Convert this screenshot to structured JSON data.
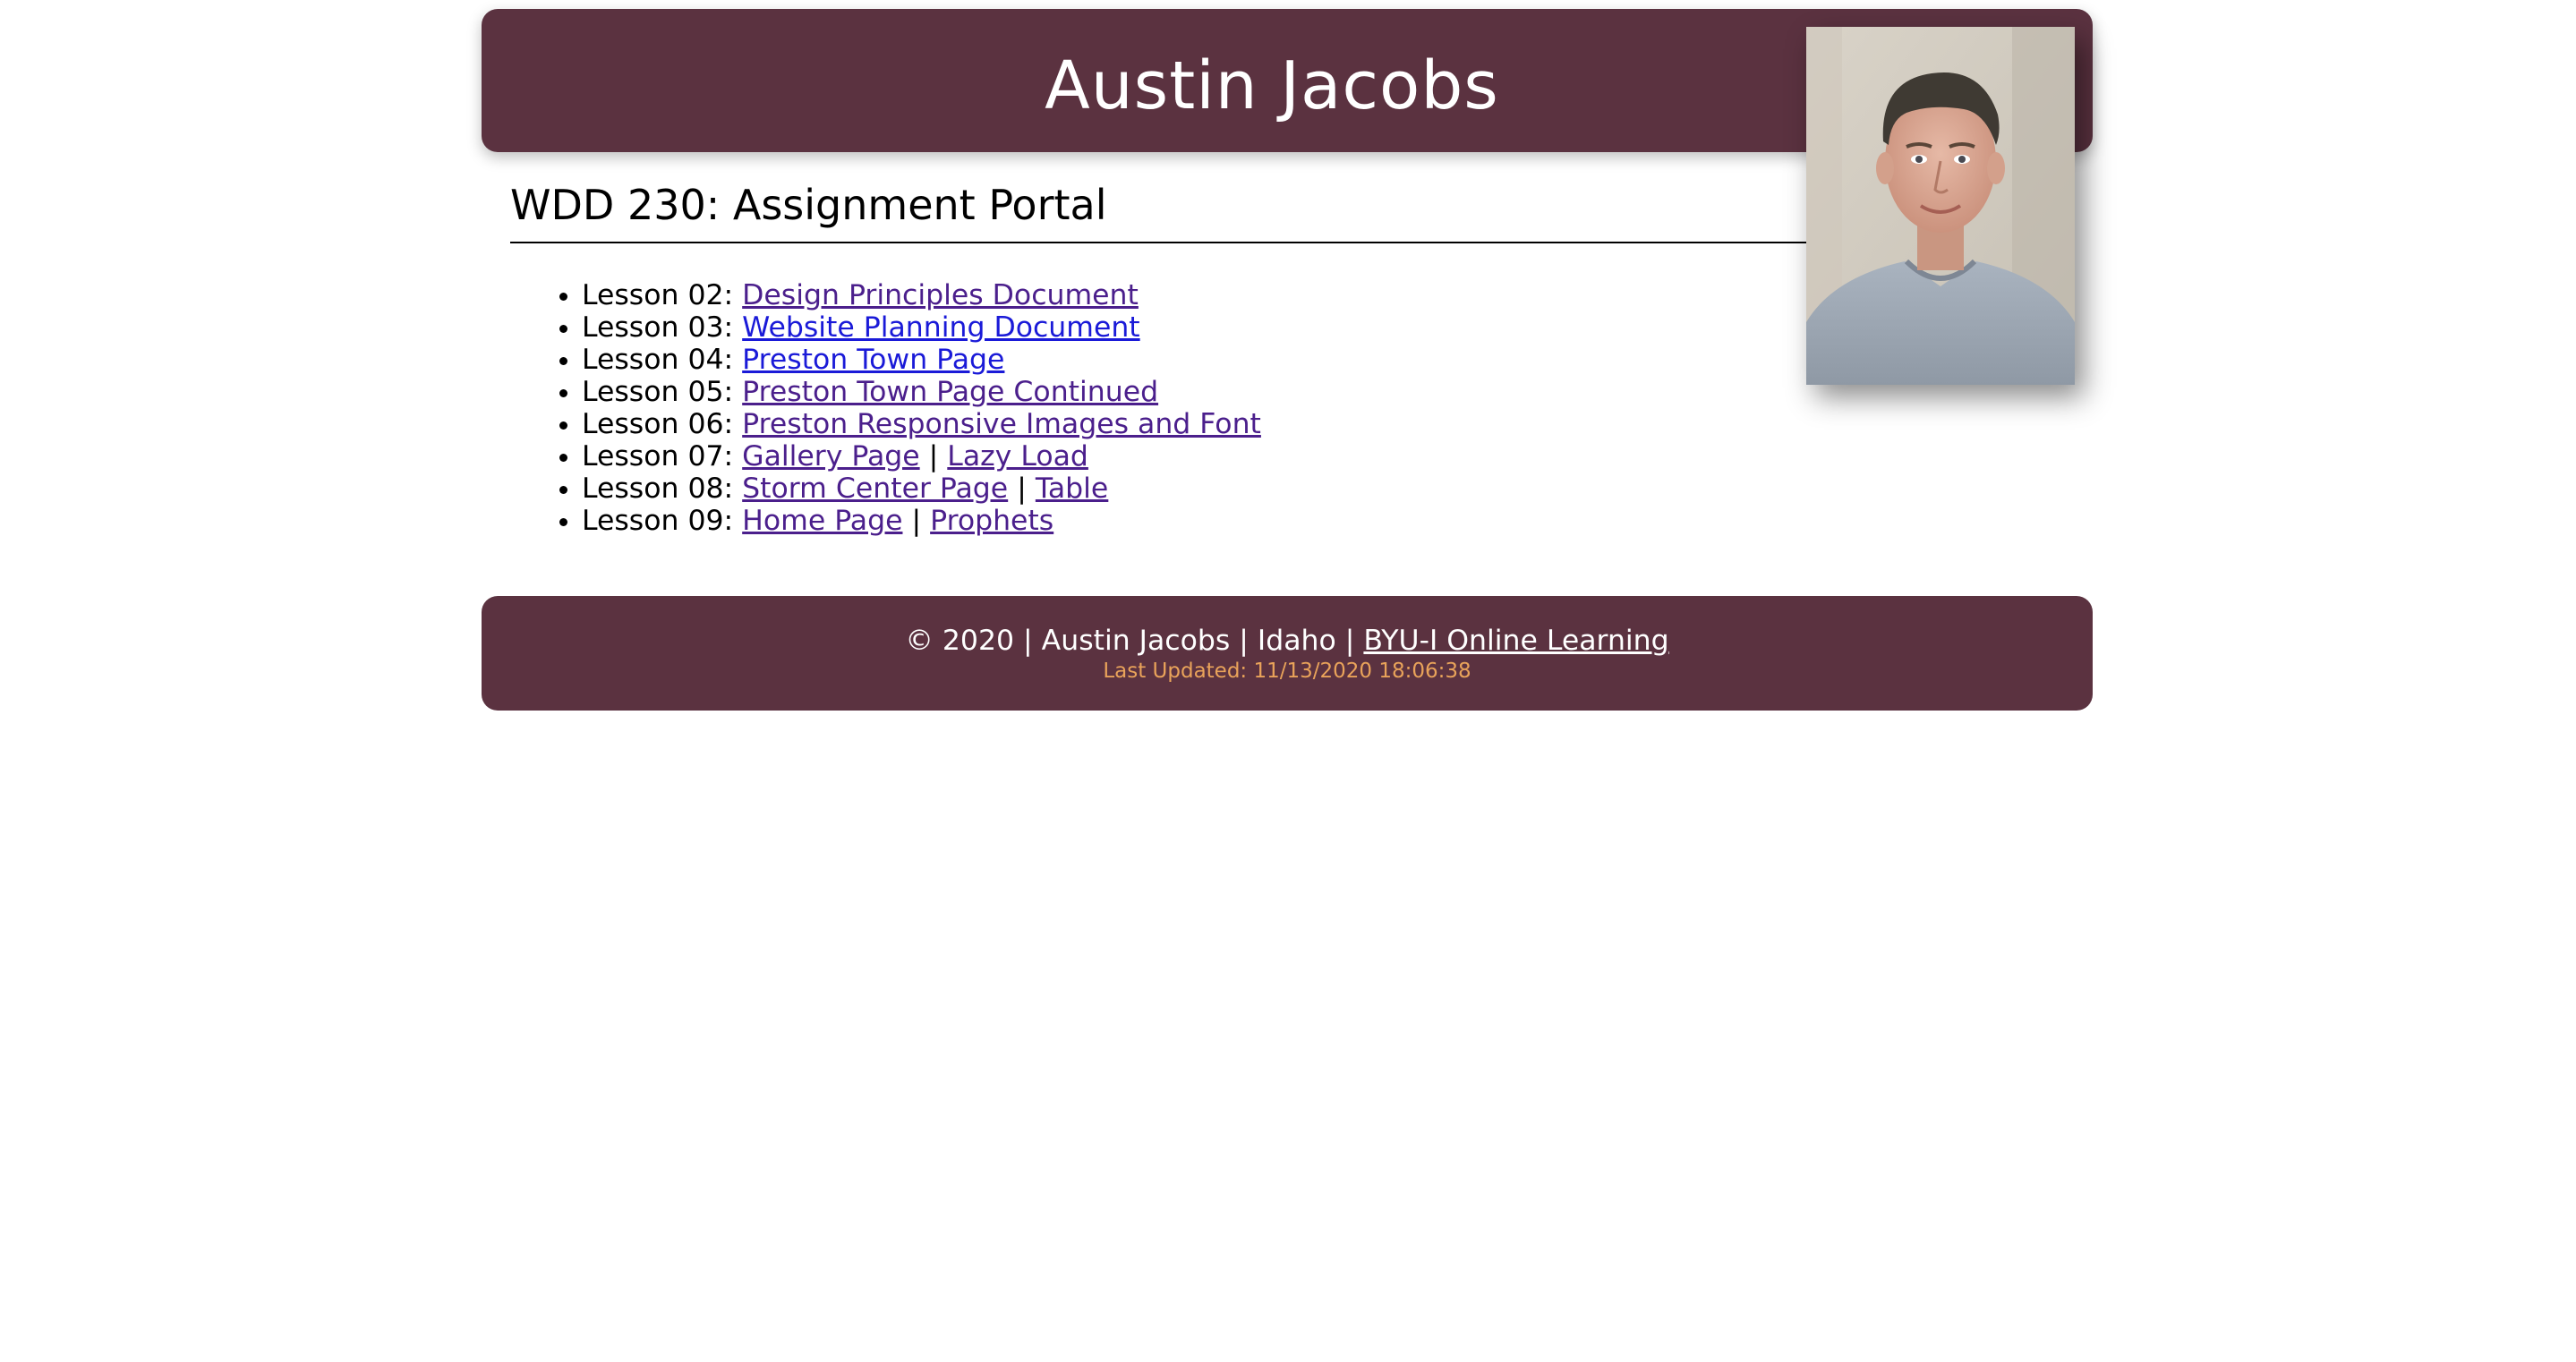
{
  "header": {
    "title": "Austin Jacobs",
    "portrait_alt": "Photo of Austin Jacobs"
  },
  "main": {
    "heading": "WDD 230: Assignment Portal",
    "lessons": [
      {
        "label": "Lesson 02:",
        "links": [
          {
            "text": "Design Principles Document"
          }
        ]
      },
      {
        "label": "Lesson 03:",
        "links": [
          {
            "text": "Website Planning Document"
          }
        ]
      },
      {
        "label": "Lesson 04:",
        "links": [
          {
            "text": "Preston Town Page"
          }
        ]
      },
      {
        "label": "Lesson 05:",
        "links": [
          {
            "text": "Preston Town Page Continued"
          }
        ]
      },
      {
        "label": "Lesson 06:",
        "links": [
          {
            "text": "Preston Responsive Images and Font"
          }
        ]
      },
      {
        "label": "Lesson 07:",
        "links": [
          {
            "text": "Gallery Page"
          },
          {
            "text": "Lazy Load"
          }
        ]
      },
      {
        "label": "Lesson 08:",
        "links": [
          {
            "text": "Storm Center Page"
          },
          {
            "text": "Table"
          }
        ]
      },
      {
        "label": "Lesson 09:",
        "links": [
          {
            "text": "Home Page"
          },
          {
            "text": "Prophets"
          }
        ]
      }
    ],
    "separator": "|"
  },
  "footer": {
    "copyright": "© 2020 | Austin Jacobs | Idaho |",
    "link": "BYU-I Online Learning",
    "last_updated": "Last Updated: 11/13/2020 18:06:38"
  },
  "colors": {
    "brand": "#5b3240",
    "visited_link": "#4b1f8c",
    "link": "#1a1ad8",
    "last_updated": "#e9a35a"
  }
}
